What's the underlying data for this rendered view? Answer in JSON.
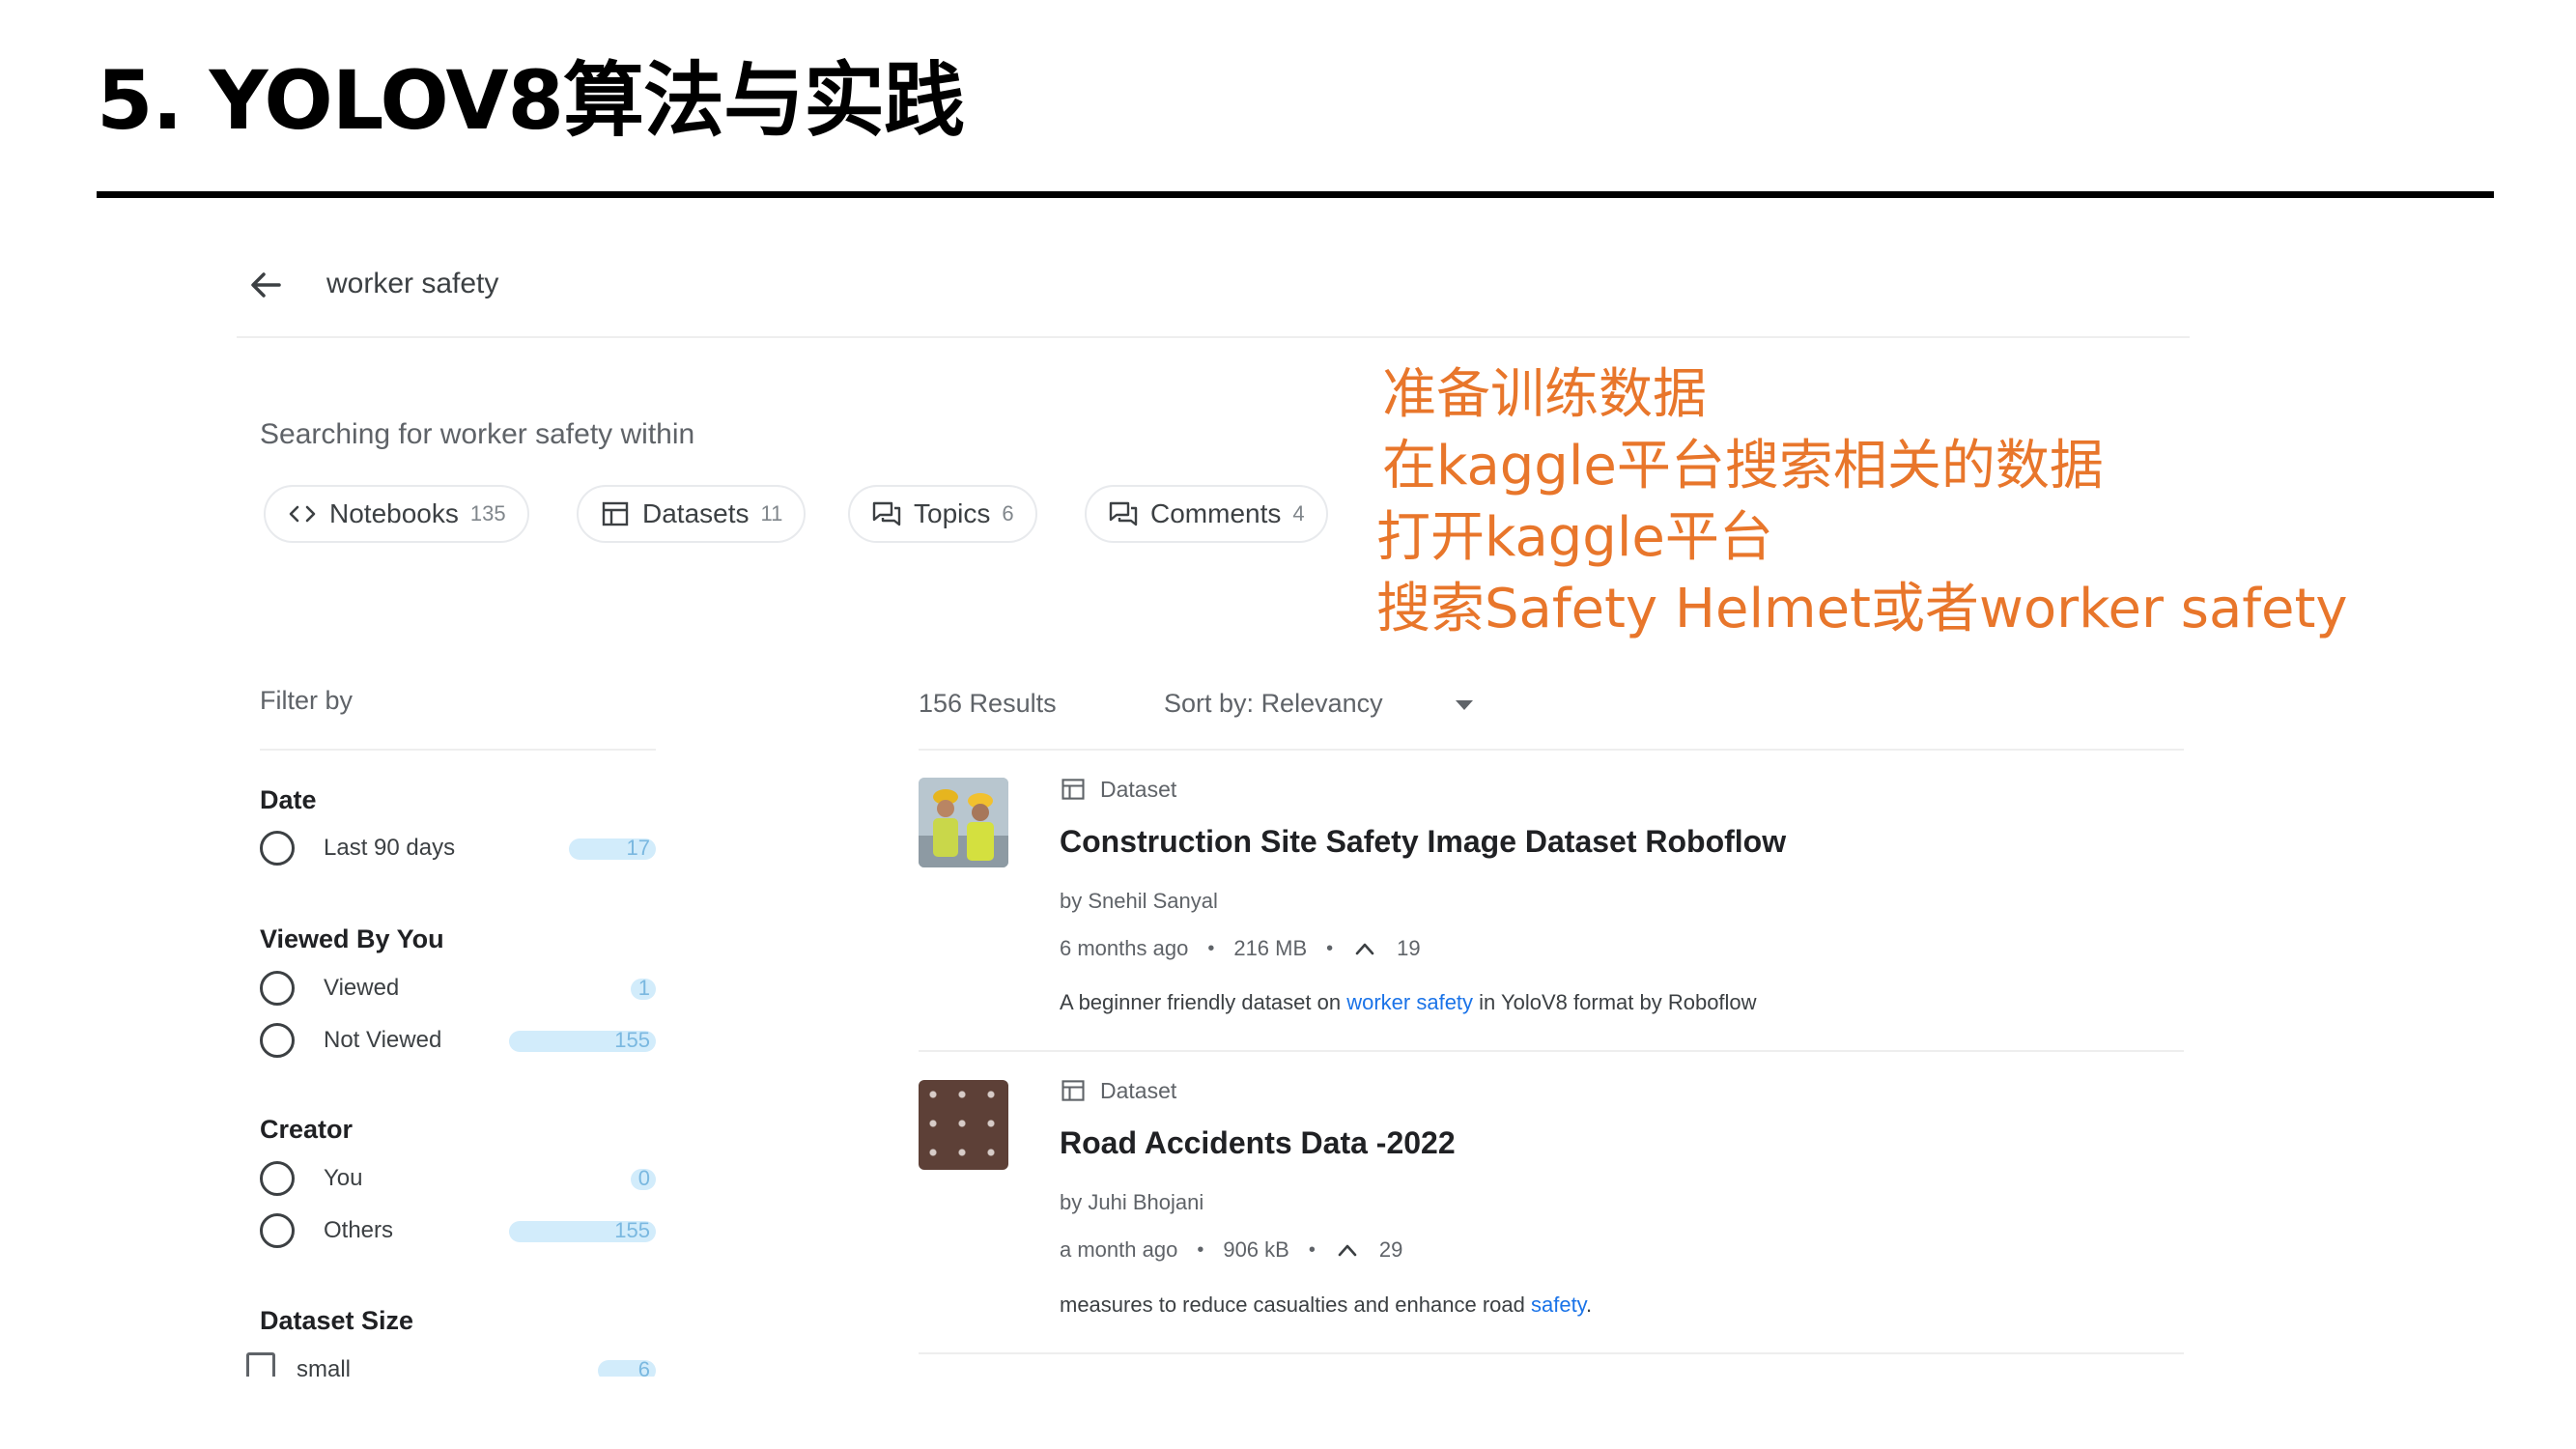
{
  "slide": {
    "title": "5. YOLOV8算法与实践"
  },
  "search": {
    "query": "worker safety",
    "searching_text": "Searching for worker safety within"
  },
  "chips": [
    {
      "label": "Notebooks",
      "count": "135",
      "icon": "code-icon"
    },
    {
      "label": "Datasets",
      "count": "11",
      "icon": "table-icon"
    },
    {
      "label": "Topics",
      "count": "6",
      "icon": "discussion-icon"
    },
    {
      "label": "Comments",
      "count": "4",
      "icon": "comment-icon"
    }
  ],
  "sidebar": {
    "filter_label": "Filter by",
    "groups": [
      {
        "title": "Date",
        "options": [
          {
            "label": "Last 90 days",
            "count": "17"
          }
        ]
      },
      {
        "title": "Viewed By You",
        "options": [
          {
            "label": "Viewed",
            "count": "1"
          },
          {
            "label": "Not Viewed",
            "count": "155"
          }
        ]
      },
      {
        "title": "Creator",
        "options": [
          {
            "label": "You",
            "count": "0"
          },
          {
            "label": "Others",
            "count": "155"
          }
        ]
      },
      {
        "title": "Dataset Size",
        "options": [
          {
            "label": "small",
            "count": "6"
          }
        ]
      }
    ]
  },
  "results_header": {
    "count": "156 Results",
    "sort_label": "Sort by:",
    "sort_value": "Relevancy"
  },
  "results": [
    {
      "type": "Dataset",
      "title": "Construction Site Safety Image Dataset Roboflow",
      "author": "by Snehil Sanyal",
      "age": "6 months ago",
      "size": "216 MB",
      "votes": "19",
      "desc_before": "A beginner friendly dataset on ",
      "desc_highlight": "worker safety",
      "desc_after": " in YoloV8 format by Roboflow"
    },
    {
      "type": "Dataset",
      "title": "Road Accidents Data -2022",
      "author": "by Juhi Bhojani",
      "age": "a month ago",
      "size": "906 kB",
      "votes": "29",
      "desc_before": "measures to reduce casualties and enhance road ",
      "desc_highlight": "safety",
      "desc_after": "."
    }
  ],
  "annotation": {
    "lines": [
      "准备训练数据",
      "在kaggle平台搜索相关的数据",
      "打开kaggle平台",
      "搜索Safety Helmet或者worker safety"
    ],
    "color": "#e8762b"
  },
  "colors": {
    "link": "#1a73e8",
    "count_bar": "#d2ecfb"
  }
}
